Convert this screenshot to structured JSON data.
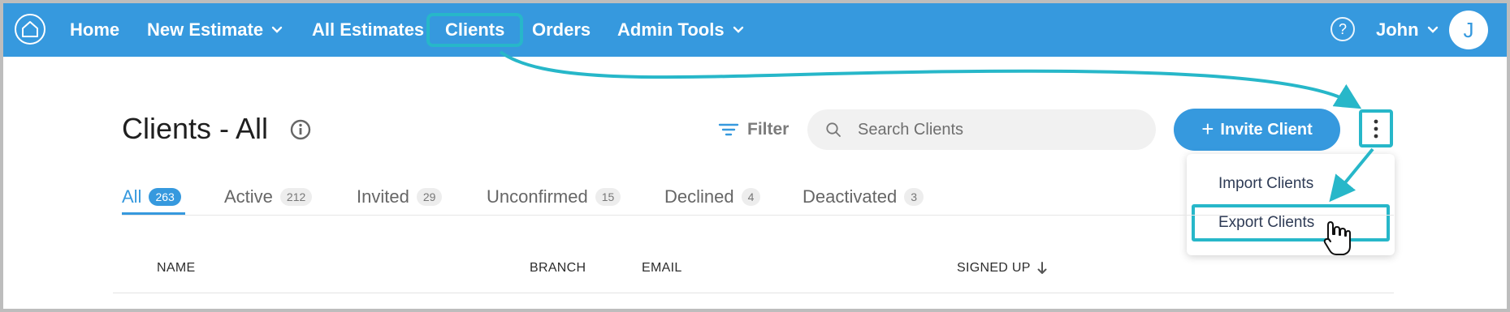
{
  "nav": {
    "logo_icon": "house-logo-icon",
    "items": [
      {
        "label": "Home"
      },
      {
        "label": "New Estimate",
        "has_dropdown": true
      },
      {
        "label": "All Estimates"
      },
      {
        "label": "Clients",
        "active": true
      },
      {
        "label": "Orders"
      },
      {
        "label": "Admin Tools",
        "has_dropdown": true
      }
    ],
    "help_label": "?",
    "user_name": "John",
    "avatar_initial": "J"
  },
  "page": {
    "title": "Clients - All",
    "filter_label": "Filter",
    "search_placeholder": "Search Clients",
    "search_value": "",
    "invite_label": "Invite Client",
    "invite_icon": "+"
  },
  "menu": {
    "items": [
      {
        "label": "Import Clients"
      },
      {
        "label": "Export Clients",
        "highlighted": true
      }
    ]
  },
  "tabs": [
    {
      "label": "All",
      "count": "263",
      "active": true
    },
    {
      "label": "Active",
      "count": "212"
    },
    {
      "label": "Invited",
      "count": "29"
    },
    {
      "label": "Unconfirmed",
      "count": "15"
    },
    {
      "label": "Declined",
      "count": "4"
    },
    {
      "label": "Deactivated",
      "count": "3"
    }
  ],
  "table": {
    "columns": [
      {
        "label": "NAME"
      },
      {
        "label": "BRANCH"
      },
      {
        "label": "EMAIL"
      },
      {
        "label": "SIGNED UP",
        "sorted": "descending"
      }
    ]
  },
  "colors": {
    "primary": "#3699de",
    "annotation": "#27b7c9",
    "text_dark": "#1f1f1f",
    "menu_text": "#2e3b55"
  }
}
